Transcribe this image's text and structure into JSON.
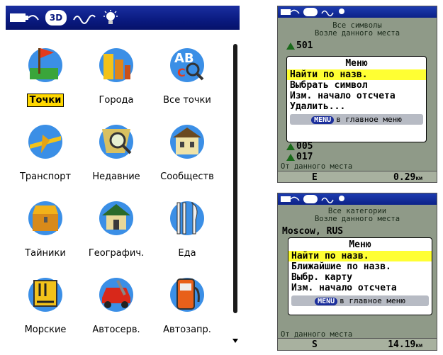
{
  "main": {
    "statusbar_icons": [
      "battery-cable-icon",
      "3d-gps-icon",
      "signal-wave-icon",
      "backlight-bulb-icon"
    ],
    "statusbar_3d": "3D",
    "items": [
      {
        "label": "Точки",
        "icon": "waypoint-flag-icon",
        "selected": true
      },
      {
        "label": "Города",
        "icon": "city-buildings-icon"
      },
      {
        "label": "Все точки",
        "icon": "abc-magnifier-icon"
      },
      {
        "label": "Транспорт",
        "icon": "airplane-icon"
      },
      {
        "label": "Недавние",
        "icon": "recent-map-magnifier-icon"
      },
      {
        "label": "Сообществ",
        "icon": "community-house-icon"
      },
      {
        "label": "Тайники",
        "icon": "treasure-chest-icon"
      },
      {
        "label": "Географич.",
        "icon": "geographic-house-icon"
      },
      {
        "label": "Еда",
        "icon": "fork-knife-icon"
      },
      {
        "label": "Морские",
        "icon": "marine-icon"
      },
      {
        "label": "Автосерв.",
        "icon": "car-service-icon"
      },
      {
        "label": "Автозапр.",
        "icon": "fuel-pump-icon"
      }
    ]
  },
  "screen1": {
    "header1": "Все символы",
    "header2": "Возле данного места",
    "row_top": "501",
    "rows_bottom": [
      "005",
      "017"
    ],
    "menu": {
      "title": "Меню",
      "items": [
        "Найти по назв.",
        "Выбрать символ",
        "Изм. начало отсчета",
        "Удалить..."
      ],
      "footer_button": "MENU",
      "footer_text": "в главное меню"
    },
    "footer_label": "От данного места",
    "direction": "E",
    "distance": "0.29",
    "distance_unit": "км"
  },
  "screen2": {
    "header1": "Все категории",
    "header2": "Возле данного места",
    "row_top": "Moscow, RUS",
    "menu": {
      "title": "Меню",
      "items": [
        "Найти по назв.",
        "Ближайшие по назв.",
        "Выбр. карту",
        "Изм. начало отсчета"
      ],
      "footer_button": "MENU",
      "footer_text": "в главное меню"
    },
    "footer_label": "От данного места",
    "direction": "S",
    "distance": "14.19",
    "distance_unit": "км"
  },
  "colors": {
    "highlight": "#ffff33",
    "selected_label": "#ffd800",
    "statusbar": "#0a1a80",
    "device_bg": "#8f9a88"
  }
}
